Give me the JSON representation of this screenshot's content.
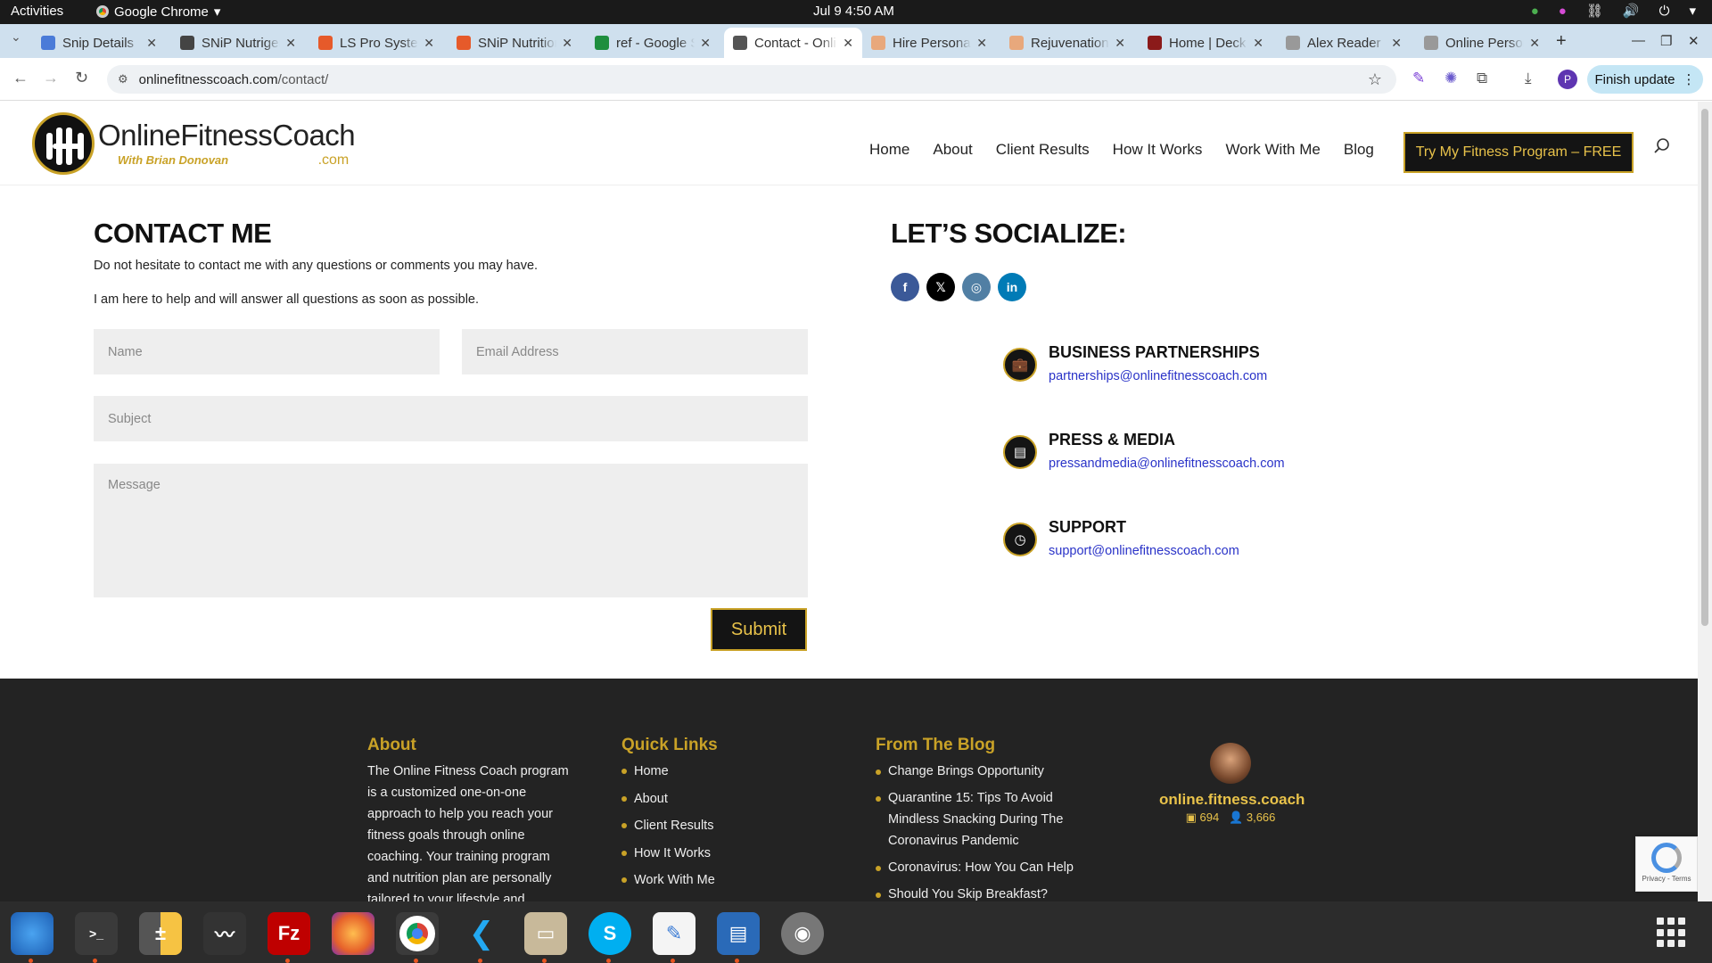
{
  "system_bar": {
    "activities": "Activities",
    "app_name": "Google Chrome",
    "clock": "Jul 9   4:50 AM"
  },
  "browser": {
    "tabs": [
      {
        "title": "Snip Details",
        "color": "#4a7bd8"
      },
      {
        "title": "SNiP Nutrigenomics",
        "color": "#444444"
      },
      {
        "title": "LS Pro System",
        "color": "#e65a2a"
      },
      {
        "title": "SNiP Nutrition",
        "color": "#e65a2a"
      },
      {
        "title": "ref - Google Sheets",
        "color": "#1e8e3e"
      },
      {
        "title": "Contact - Online Fitness",
        "color": "#555555"
      },
      {
        "title": "Hire Personal",
        "color": "#e8a87c"
      },
      {
        "title": "Rejuvenation",
        "color": "#e8a87c"
      },
      {
        "title": "Home | Deck",
        "color": "#8b1a1a"
      },
      {
        "title": "Alex Reader",
        "color": "#999999"
      },
      {
        "title": "Online Personal",
        "color": "#999999"
      }
    ],
    "active_tab_index": 5,
    "url_domain": "onlinefitnesscoach.com",
    "url_path": "/contact/",
    "finish_update": "Finish update",
    "profile_initial": "P"
  },
  "site": {
    "logo_brand": "OnlineFitnessCoach",
    "logo_tagline": "With Brian Donovan",
    "logo_suffix": ".com",
    "nav": [
      "Home",
      "About",
      "Client Results",
      "How It Works",
      "Work With Me",
      "Blog"
    ],
    "cta": "Try My Fitness Program – FREE",
    "accent_color": "#c9a227"
  },
  "contact": {
    "heading": "CONTACT ME",
    "line1": "Do not hesitate to contact me with any questions or comments you may have.",
    "line2": "I am here to help and will answer all questions as soon as possible.",
    "name_placeholder": "Name",
    "email_placeholder": "Email Address",
    "subject_placeholder": "Subject",
    "message_placeholder": "Message",
    "submit": "Submit"
  },
  "social": {
    "heading": "LET’S SOCIALIZE:",
    "networks": [
      {
        "name": "facebook-icon",
        "glyph": "f",
        "color": "#3b5998"
      },
      {
        "name": "x-twitter-icon",
        "glyph": "𝕏",
        "color": "#000000"
      },
      {
        "name": "instagram-icon",
        "glyph": "◎",
        "color": "#517fa4"
      },
      {
        "name": "linkedin-icon",
        "glyph": "in",
        "color": "#007bb6"
      }
    ],
    "contacts": [
      {
        "title": "BUSINESS PARTNERSHIPS",
        "email": "partnerships@onlinefitnesscoach.com",
        "icon": "briefcase-icon"
      },
      {
        "title": "PRESS & MEDIA",
        "email": "pressandmedia@onlinefitnesscoach.com",
        "icon": "document-icon"
      },
      {
        "title": "SUPPORT",
        "email": "support@onlinefitnesscoach.com",
        "icon": "history-icon"
      }
    ]
  },
  "footer": {
    "about_heading": "About",
    "about_text": "The Online Fitness Coach program is a customized one-on-one approach to help you reach your fitness goals through online coaching. Your training program and nutrition plan are personally tailored to your lifestyle and",
    "links_heading": "Quick Links",
    "links": [
      "Home",
      "About",
      "Client Results",
      "How It Works",
      "Work With Me"
    ],
    "blog_heading": "From The Blog",
    "blog_posts": [
      "Change Brings Opportunity",
      "Quarantine 15: Tips To Avoid Mindless Snacking During The Coronavirus Pandemic",
      "Coronavirus: How You Can Help",
      "Should You Skip Breakfast?"
    ],
    "instagram_handle": "online.fitness.coach",
    "posts_count": "694",
    "followers_count": "3,666"
  },
  "recaptcha": {
    "text": "Privacy - Terms"
  }
}
